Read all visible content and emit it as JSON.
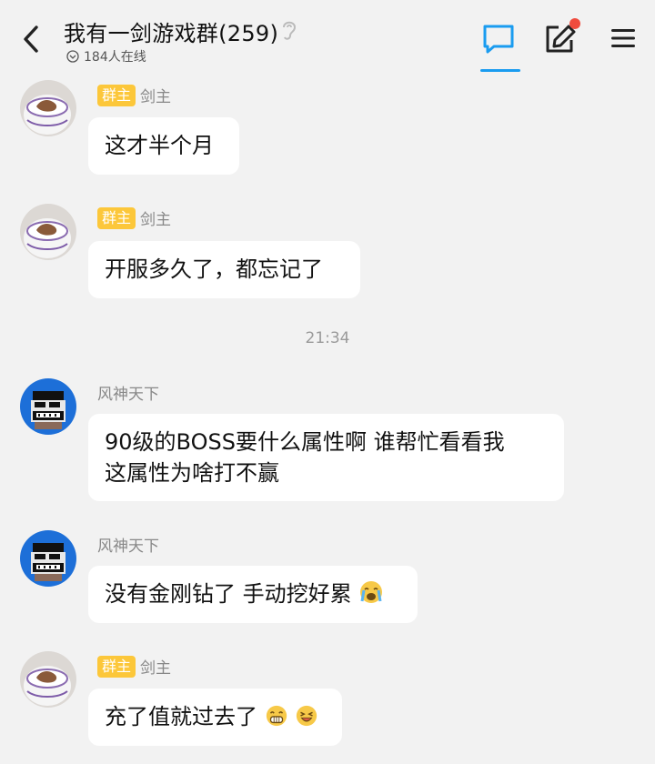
{
  "header": {
    "title": "我有一剑游戏群(259)",
    "online_count": "184人在线"
  },
  "messages": [
    {
      "sender": "剑主",
      "badge": "群主",
      "text": "这才半个月"
    },
    {
      "sender": "剑主",
      "badge": "群主",
      "text": "开服多久了，都忘记了"
    },
    {
      "sender": "风神天下",
      "line1": "90级的BOSS要什么属性啊 谁帮忙看看我",
      "line2": "这属性为啥打不赢"
    },
    {
      "sender": "风神天下",
      "text": "没有金刚钻了 手动挖好累"
    },
    {
      "sender": "剑主",
      "badge": "群主",
      "text": "充了值就过去了"
    }
  ],
  "timestamp": "21:34",
  "colors": {
    "accent": "#1a9cf0",
    "badge": "#fcc73a",
    "notification": "#f04c3e",
    "background": "#f2f2f2"
  }
}
